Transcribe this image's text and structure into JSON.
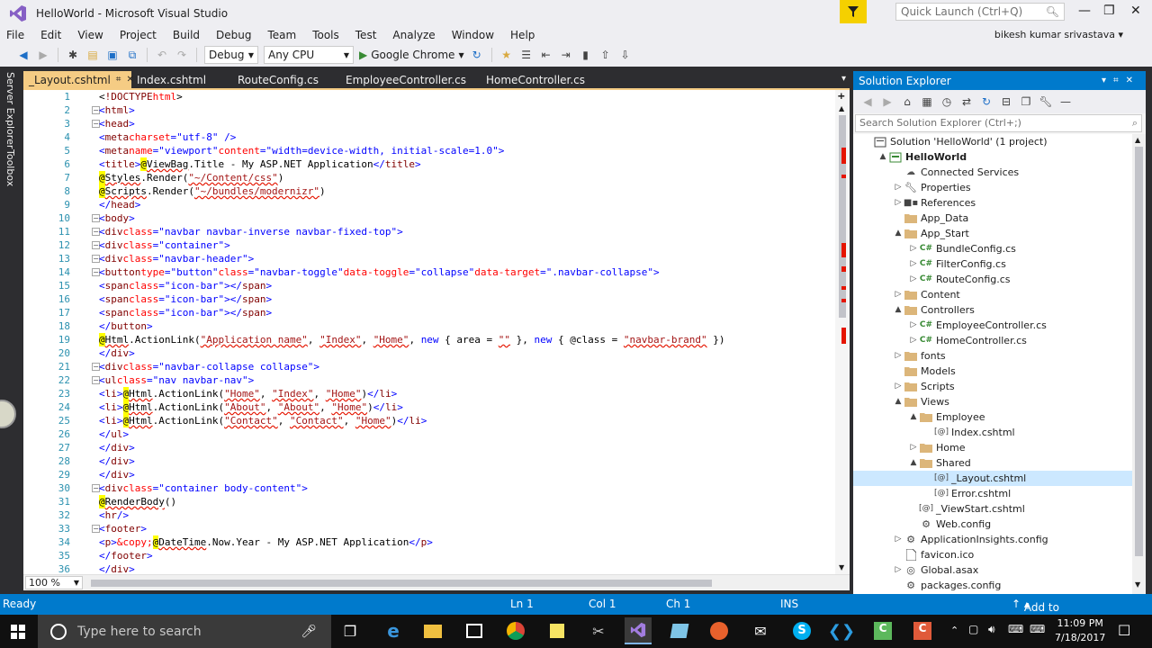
{
  "window": {
    "title": "HelloWorld - Microsoft Visual Studio",
    "quick_launch_placeholder": "Quick Launch (Ctrl+Q)"
  },
  "menu": [
    "File",
    "Edit",
    "View",
    "Project",
    "Build",
    "Debug",
    "Team",
    "Tools",
    "Test",
    "Analyze",
    "Window",
    "Help"
  ],
  "user": "bikesh kumar srivastava",
  "toolbar": {
    "config": "Debug",
    "platform": "Any CPU",
    "run_target": "Google Chrome"
  },
  "left_rail": [
    "Server Explorer",
    "Toolbox"
  ],
  "tabs": [
    {
      "label": "_Layout.cshtml",
      "active": true
    },
    {
      "label": "Index.cshtml"
    },
    {
      "label": "RouteConfig.cs"
    },
    {
      "label": "EmployeeController.cs"
    },
    {
      "label": "HomeController.cs"
    }
  ],
  "editor": {
    "line_numbers": [
      "1",
      "2",
      "3",
      "4",
      "5",
      "6",
      "7",
      "8",
      "9",
      "10",
      "11",
      "12",
      "13",
      "14",
      "15",
      "16",
      "17",
      "18",
      "19",
      "20",
      "21",
      "22",
      "23",
      "24",
      "25",
      "26",
      "27",
      "28",
      "29",
      "30",
      "31",
      "32",
      "33",
      "34",
      "35",
      "36"
    ],
    "zoom": "100 %"
  },
  "solution_explorer": {
    "title": "Solution Explorer",
    "search_placeholder": "Search Solution Explorer (Ctrl+;)",
    "nodes": [
      {
        "label": "Solution 'HelloWorld' (1 project)",
        "depth": 0,
        "icon": "solution-icon",
        "arrow": ""
      },
      {
        "label": "HelloWorld",
        "depth": 1,
        "icon": "project-icon",
        "arrow": "▲",
        "bold": true
      },
      {
        "label": "Connected Services",
        "depth": 2,
        "icon": "cloud-icon",
        "arrow": ""
      },
      {
        "label": "Properties",
        "depth": 2,
        "icon": "wrench-icon",
        "arrow": "▷"
      },
      {
        "label": "References",
        "depth": 2,
        "icon": "references-icon",
        "arrow": "▷"
      },
      {
        "label": "App_Data",
        "depth": 2,
        "icon": "folder-icon",
        "arrow": ""
      },
      {
        "label": "App_Start",
        "depth": 2,
        "icon": "folder-icon",
        "arrow": "▲"
      },
      {
        "label": "BundleConfig.cs",
        "depth": 3,
        "icon": "csharp-icon",
        "arrow": "▷"
      },
      {
        "label": "FilterConfig.cs",
        "depth": 3,
        "icon": "csharp-icon",
        "arrow": "▷"
      },
      {
        "label": "RouteConfig.cs",
        "depth": 3,
        "icon": "csharp-icon",
        "arrow": "▷"
      },
      {
        "label": "Content",
        "depth": 2,
        "icon": "folder-icon",
        "arrow": "▷"
      },
      {
        "label": "Controllers",
        "depth": 2,
        "icon": "folder-icon",
        "arrow": "▲"
      },
      {
        "label": "EmployeeController.cs",
        "depth": 3,
        "icon": "csharp-icon",
        "arrow": "▷"
      },
      {
        "label": "HomeController.cs",
        "depth": 3,
        "icon": "csharp-icon",
        "arrow": "▷"
      },
      {
        "label": "fonts",
        "depth": 2,
        "icon": "folder-icon",
        "arrow": "▷"
      },
      {
        "label": "Models",
        "depth": 2,
        "icon": "folder-icon",
        "arrow": ""
      },
      {
        "label": "Scripts",
        "depth": 2,
        "icon": "folder-icon",
        "arrow": "▷"
      },
      {
        "label": "Views",
        "depth": 2,
        "icon": "folder-icon",
        "arrow": "▲"
      },
      {
        "label": "Employee",
        "depth": 3,
        "icon": "folder-icon",
        "arrow": "▲"
      },
      {
        "label": "Index.cshtml",
        "depth": 4,
        "icon": "razor-icon",
        "arrow": ""
      },
      {
        "label": "Home",
        "depth": 3,
        "icon": "folder-icon",
        "arrow": "▷"
      },
      {
        "label": "Shared",
        "depth": 3,
        "icon": "folder-icon",
        "arrow": "▲"
      },
      {
        "label": "_Layout.cshtml",
        "depth": 4,
        "icon": "razor-icon",
        "arrow": "",
        "selected": true
      },
      {
        "label": "Error.cshtml",
        "depth": 4,
        "icon": "razor-icon",
        "arrow": ""
      },
      {
        "label": "_ViewStart.cshtml",
        "depth": 3,
        "icon": "razor-icon",
        "arrow": ""
      },
      {
        "label": "Web.config",
        "depth": 3,
        "icon": "config-icon",
        "arrow": ""
      },
      {
        "label": "ApplicationInsights.config",
        "depth": 2,
        "icon": "config-icon",
        "arrow": "▷"
      },
      {
        "label": "favicon.ico",
        "depth": 2,
        "icon": "file-icon",
        "arrow": ""
      },
      {
        "label": "Global.asax",
        "depth": 2,
        "icon": "globe-icon",
        "arrow": "▷"
      },
      {
        "label": "packages.config",
        "depth": 2,
        "icon": "config-icon",
        "arrow": ""
      }
    ]
  },
  "status": {
    "state": "Ready",
    "ln": "Ln 1",
    "col": "Col 1",
    "ch": "Ch 1",
    "mode": "INS",
    "source_control": "Add to Source Control"
  },
  "taskbar": {
    "search_placeholder": "Type here to search",
    "time": "11:09 PM",
    "date": "7/18/2017"
  },
  "colors": {
    "accent": "#007acc",
    "tab_active": "#f5cc84",
    "error_marker": "#e51400"
  }
}
